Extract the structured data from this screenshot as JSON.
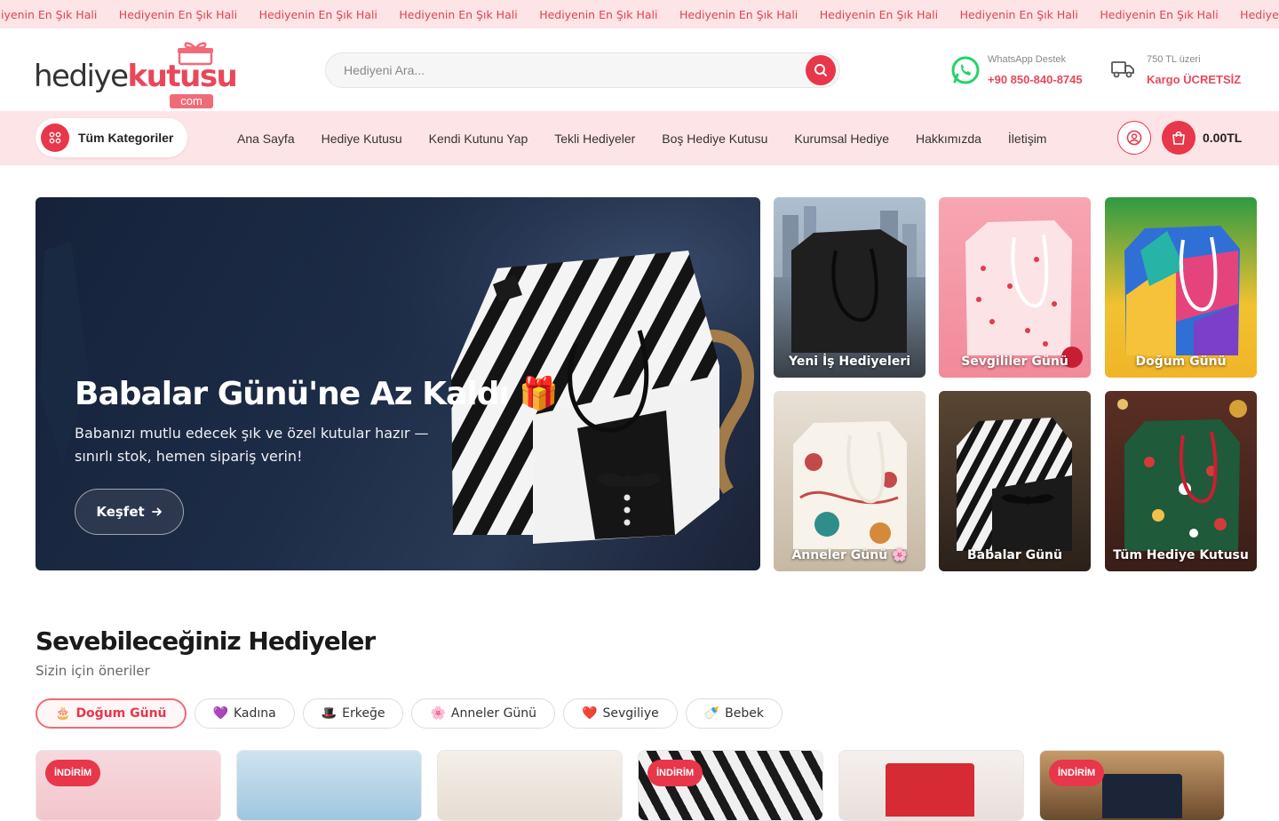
{
  "ticker": {
    "items": [
      "Hediyenin En Şık Hali",
      "Hediyenin En Şık Hali",
      "Hediyenin En Şık Hali",
      "Hediyenin En Şık Hali",
      "Hediyenin En Şık Hali",
      "Hediyenin En Şık Hali",
      "Hediyenin En Şık Hali",
      "Hediyenin En Şık Hali",
      "Hediyenin En Şık Hali",
      "Hediyenin En Şık Hali",
      "Hediyenin En Şık Hali"
    ],
    "color": "#e0434f"
  },
  "header": {
    "logo": {
      "text_a": "hediye",
      "text_b": "kutusu",
      "suffix": "com"
    },
    "search_placeholder": "Hediyeni Ara...",
    "search_icon": "search-icon",
    "whatsapp": {
      "label": "WhatsApp Destek",
      "phone": "+90 850-840-8745",
      "icon": "whatsapp-icon"
    },
    "cargo": {
      "label": "750 TL üzeri",
      "text": "Kargo ÜCRETSİZ",
      "icon": "truck-icon"
    }
  },
  "nav": {
    "categories_label": "Tüm Kategoriler",
    "links": [
      "Ana Sayfa",
      "Hediye Kutusu",
      "Kendi Kutunu Yap",
      "Tekli Hediyeler",
      "Boş Hediye Kutusu",
      "Kurumsal Hediye",
      "Hakkımızda",
      "İletişim"
    ],
    "cart_total": "0.00TL"
  },
  "hero": {
    "title": "Babalar Günü'ne Az Kaldı 🎁",
    "subtitle": "Babanızı mutlu edecek şık ve özel kutular hazır — sınırlı stok, hemen sipariş verin!",
    "button": "Keşfet",
    "button_icon": "arrow-right-icon"
  },
  "tiles": [
    {
      "label": "Yeni İş Hediyeleri"
    },
    {
      "label": "Sevgililer Günü"
    },
    {
      "label": "Doğum Günü"
    },
    {
      "label": "Anneler Günü 🌸"
    },
    {
      "label": "Babalar Günü"
    },
    {
      "label": "Tüm Hediye Kutusu"
    }
  ],
  "section": {
    "title": "Sevebileceğiniz Hediyeler",
    "subtitle": "Sizin için öneriler",
    "chips": [
      {
        "emoji": "🎂",
        "label": "Doğum Günü",
        "active": true
      },
      {
        "emoji": "💜",
        "label": "Kadına",
        "active": false
      },
      {
        "emoji": "🎩",
        "label": "Erkeğe",
        "active": false
      },
      {
        "emoji": "🌸",
        "label": "Anneler Günü",
        "active": false
      },
      {
        "emoji": "❤️",
        "label": "Sevgiliye",
        "active": false
      },
      {
        "emoji": "🍼",
        "label": "Bebek",
        "active": false
      }
    ]
  },
  "products": [
    {
      "badge": "İNDİRİM"
    },
    {
      "badge": ""
    },
    {
      "badge": ""
    },
    {
      "badge": "İNDİRİM"
    },
    {
      "badge": ""
    },
    {
      "badge": "İNDİRİM"
    }
  ],
  "colors": {
    "accent": "#e8364a",
    "nav_bg": "#fde4e6"
  }
}
